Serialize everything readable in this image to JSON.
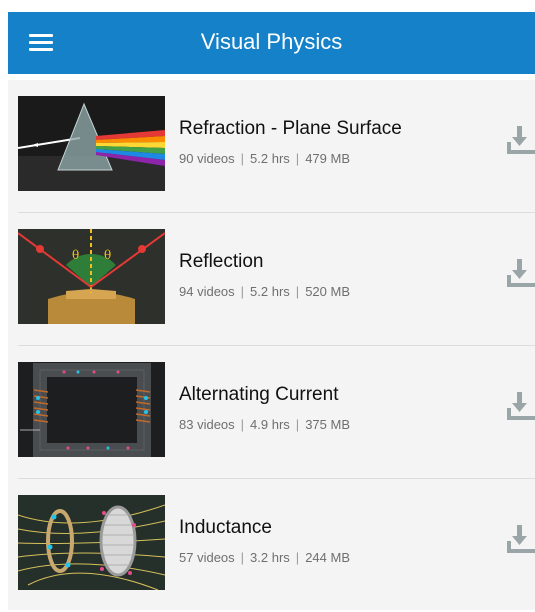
{
  "app": {
    "title": "Visual Physics",
    "accent_color": "#1481c8",
    "menu_icon": "hamburger-menu-icon"
  },
  "courses": [
    {
      "title": "Refraction - Plane Surface",
      "videos": "90 videos",
      "duration": "5.2 hrs",
      "size": "479 MB",
      "thumbnail": "prism-rainbow-thumbnail"
    },
    {
      "title": "Reflection",
      "videos": "94 videos",
      "duration": "5.2 hrs",
      "size": "520 MB",
      "thumbnail": "mirror-reflection-thumbnail"
    },
    {
      "title": "Alternating Current",
      "videos": "83 videos",
      "duration": "4.9 hrs",
      "size": "375 MB",
      "thumbnail": "coil-core-thumbnail"
    },
    {
      "title": "Inductance",
      "videos": "57 videos",
      "duration": "3.2 hrs",
      "size": "244 MB",
      "thumbnail": "coil-field-thumbnail"
    }
  ],
  "download_icon": "download-icon",
  "separator": "|"
}
